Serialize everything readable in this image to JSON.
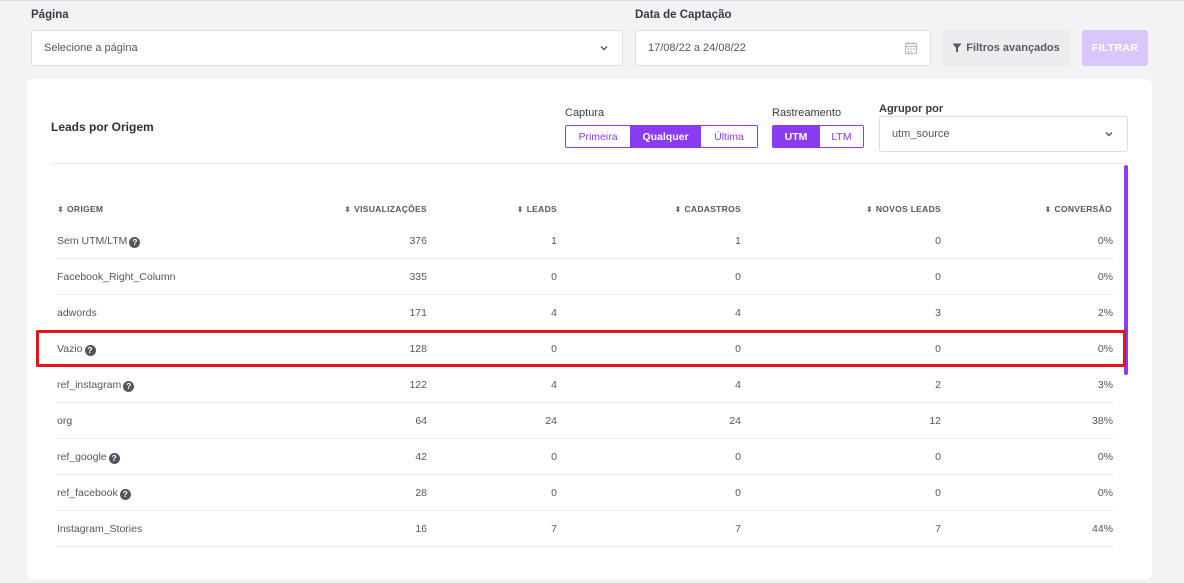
{
  "filters": {
    "page_label": "Página",
    "page_placeholder": "Selecione a página",
    "date_label": "Data de Captação",
    "date_value": "17/08/22 a 24/08/22",
    "advanced_label": "Filtros avançados",
    "filter_button": "FILTRAR"
  },
  "card": {
    "title": "Leads por Origem",
    "captura_label": "Captura",
    "captura_options": [
      "Primeira",
      "Qualquer",
      "Última"
    ],
    "captura_selected": "Qualquer",
    "rastreamento_label": "Rastreamento",
    "rastreamento_options": [
      "UTM",
      "LTM"
    ],
    "rastreamento_selected": "UTM",
    "agrupar_label": "Agrupor por",
    "agrupar_value": "utm_source"
  },
  "table": {
    "headers": [
      "ORIGEM",
      "VISUALIZAÇÕES",
      "LEADS",
      "CADASTROS",
      "NOVOS LEADS",
      "CONVERSÃO"
    ],
    "rows": [
      {
        "origem": "Sem UTM/LTM",
        "help": true,
        "visualizacoes": "376",
        "leads": "1",
        "cadastros": "1",
        "novos_leads": "0",
        "conversao": "0%"
      },
      {
        "origem": "Facebook_Right_Column",
        "help": false,
        "visualizacoes": "335",
        "leads": "0",
        "cadastros": "0",
        "novos_leads": "0",
        "conversao": "0%"
      },
      {
        "origem": "adwords",
        "help": false,
        "visualizacoes": "171",
        "leads": "4",
        "cadastros": "4",
        "novos_leads": "3",
        "conversao": "2%"
      },
      {
        "origem": "Vazio",
        "help": true,
        "visualizacoes": "128",
        "leads": "0",
        "cadastros": "0",
        "novos_leads": "0",
        "conversao": "0%"
      },
      {
        "origem": "ref_instagram",
        "help": true,
        "visualizacoes": "122",
        "leads": "4",
        "cadastros": "4",
        "novos_leads": "2",
        "conversao": "3%"
      },
      {
        "origem": "org",
        "help": false,
        "visualizacoes": "64",
        "leads": "24",
        "cadastros": "24",
        "novos_leads": "12",
        "conversao": "38%"
      },
      {
        "origem": "ref_google",
        "help": true,
        "visualizacoes": "42",
        "leads": "0",
        "cadastros": "0",
        "novos_leads": "0",
        "conversao": "0%"
      },
      {
        "origem": "ref_facebook",
        "help": true,
        "visualizacoes": "28",
        "leads": "0",
        "cadastros": "0",
        "novos_leads": "0",
        "conversao": "0%"
      },
      {
        "origem": "Instagram_Stories",
        "help": false,
        "visualizacoes": "16",
        "leads": "7",
        "cadastros": "7",
        "novos_leads": "7",
        "conversao": "44%"
      }
    ],
    "highlighted_row": "Vazio"
  },
  "icons": {
    "chevron": "chevron-down-icon",
    "calendar": "calendar-icon",
    "filter": "filter-icon",
    "sort": "sort-icon",
    "help": "help-icon"
  },
  "colors": {
    "accent": "#8a3cf2",
    "filter_button_bg": "#d9c7fb",
    "highlight_border": "#e5141b"
  }
}
